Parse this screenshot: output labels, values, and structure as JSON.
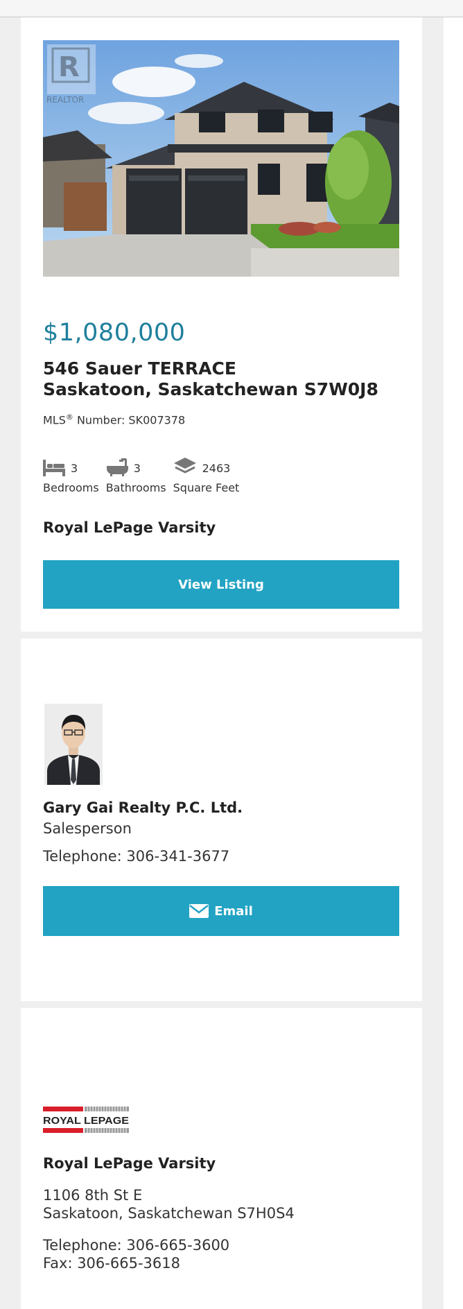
{
  "listing": {
    "photo_watermark": "REALTOR",
    "price": "$1,080,000",
    "address_line1": "546 Sauer TERRACE",
    "address_line2": "Saskatoon, Saskatchewan S7W0J8",
    "mls_prefix": "MLS",
    "mls_mark": "®",
    "mls_label": " Number: SK007378",
    "stats": [
      {
        "icon": "bed-icon",
        "value": "3",
        "label": "Bedrooms"
      },
      {
        "icon": "bathtub-icon",
        "value": "3",
        "label": "Bathrooms"
      },
      {
        "icon": "layers-icon",
        "value": "2463",
        "label": "Square Feet"
      }
    ],
    "brokerage": "Royal LePage Varsity",
    "view_button": "View Listing"
  },
  "agent": {
    "name": "Gary Gai Realty P.C. Ltd.",
    "role": "Salesperson",
    "phone": "Telephone: 306-341-3677",
    "email_button": "Email",
    "email_icon": "envelope-icon"
  },
  "office": {
    "logo_text": "ROYAL LEPAGE",
    "name": "Royal LePage Varsity",
    "address_line1": "1106 8th St E",
    "address_line2": "Saskatoon, Saskatchewan S7H0S4",
    "telephone": "Telephone: 306-665-3600",
    "fax": "Fax: 306-665-3618"
  },
  "colors": {
    "accent": "#22a3c3",
    "price": "#1f7f9c",
    "page_bg": "#efefef",
    "logo_red": "#d81e2a"
  }
}
